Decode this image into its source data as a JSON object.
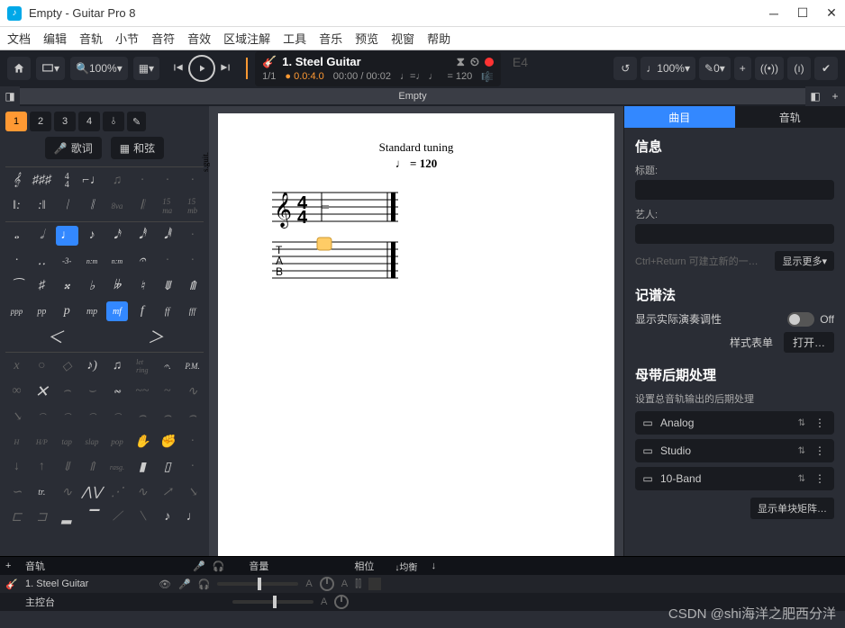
{
  "window": {
    "title": "Empty - Guitar Pro 8"
  },
  "menu": [
    "文档",
    "编辑",
    "音轨",
    "小节",
    "音符",
    "音效",
    "区域注解",
    "工具",
    "音乐",
    "预览",
    "视窗",
    "帮助"
  ],
  "toolbar": {
    "zoom": "100%",
    "track_name": "1. Steel Guitar",
    "bar_pos": "1/1",
    "beat_pos": "0.0:4.0",
    "time_cur": "00:00",
    "time_tot": "00:02",
    "tempo_sym": "♩=♩ ♩",
    "tempo_val": "= 120",
    "note_pct": "100%",
    "pen_val": "0",
    "eq": "E4"
  },
  "tabbar": {
    "tab": "Empty"
  },
  "left": {
    "views": [
      "1",
      "2",
      "3",
      "4"
    ],
    "lyrics": "歌词",
    "chords": "和弦"
  },
  "score": {
    "tuning": "Standard tuning",
    "tempo": "♩ = 120",
    "vert": "s.guit."
  },
  "right": {
    "tabs": [
      "曲目",
      "音轨"
    ],
    "info_h": "信息",
    "title_l": "标题:",
    "artist_l": "艺人:",
    "hint": "Ctrl+Return 可建立新的一…",
    "more": "显示更多",
    "notation_h": "记谱法",
    "display_tonality": "显示实际演奏调性",
    "off": "Off",
    "stylesheet": "样式表单",
    "open": "打开…",
    "mastering_h": "母带后期处理",
    "mastering_sub": "设置总音轨输出的后期处理",
    "fx": [
      "Analog",
      "Studio",
      "10-Band"
    ],
    "matrix": "显示单块矩阵…"
  },
  "bottom": {
    "track_h": "音轨",
    "vol_h": "音量",
    "pan_h": "相位",
    "eq_h": "均衡",
    "track1": "1. Steel Guitar",
    "master": "主控台"
  },
  "watermark": "CSDN @shi海洋之肥西分洋"
}
